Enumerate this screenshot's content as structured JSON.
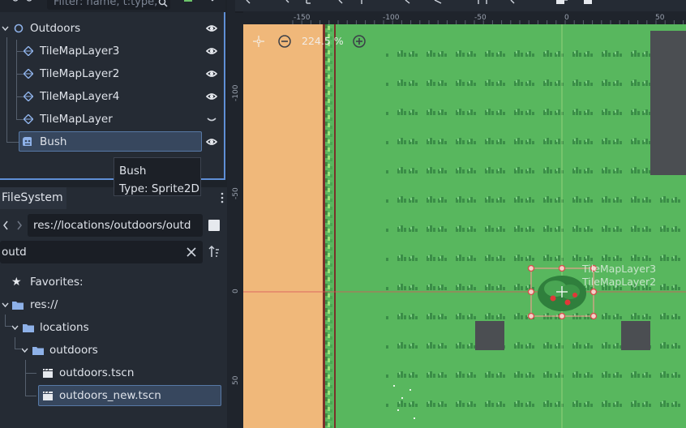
{
  "scene_tree": {
    "filter_placeholder": "Filter: name, t:type,",
    "nodes": [
      {
        "label": "Outdoors"
      },
      {
        "label": "TileMapLayer3"
      },
      {
        "label": "TileMapLayer2"
      },
      {
        "label": "TileMapLayer4"
      },
      {
        "label": "TileMapLayer"
      },
      {
        "label": "Bush"
      }
    ]
  },
  "tooltip": {
    "name": "Bush",
    "type": "Type: Sprite2D"
  },
  "filesystem": {
    "tab_label": "FileSystem",
    "path": "res://locations/outdoors/outd",
    "search_value": "outd",
    "items": [
      {
        "label": "Favorites:"
      },
      {
        "label": "res://"
      },
      {
        "label": "locations"
      },
      {
        "label": "outdoors"
      },
      {
        "label": "outdoors.tscn"
      },
      {
        "label": "outdoors_new.tscn"
      }
    ]
  },
  "viewport": {
    "zoom_label": "224.5 %",
    "ruler_top": [
      "-150",
      "-100",
      "-50",
      "0",
      "50"
    ],
    "ruler_left": [
      "-100",
      "-50",
      "0",
      "50"
    ],
    "overlay_labels": [
      "TileMapLayer3",
      "TileMapLayer2"
    ]
  },
  "colors": {
    "accent": "#5f8fd6",
    "grass": "#58b75e",
    "sand": "#f0b87a",
    "selection": "#e8a08c"
  }
}
